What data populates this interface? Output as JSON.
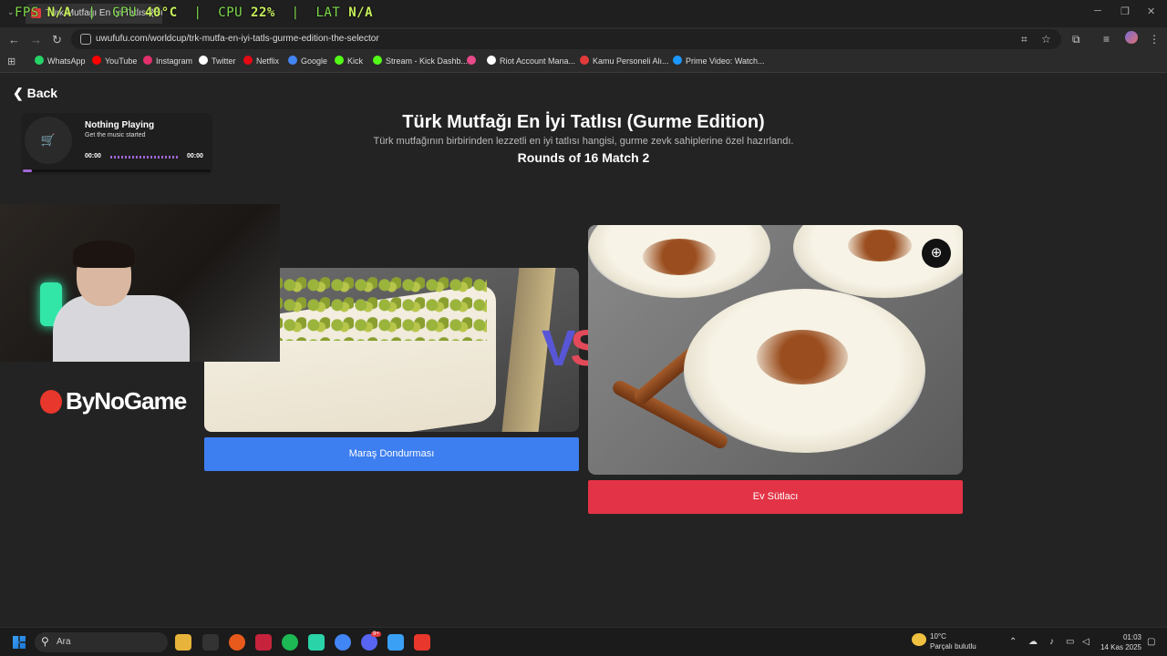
{
  "browser": {
    "tab_title": "Türk Mutfağı En İyi Tatlısı (Gurme",
    "url": "uwufufu.com/worldcup/trk-mutfa-en-iyi-tatls-gurme-edition-the-selector",
    "bookmarks": [
      {
        "label": "WhatsApp",
        "color": "#25d366"
      },
      {
        "label": "YouTube",
        "color": "#ff0000"
      },
      {
        "label": "Instagram",
        "color": "#e1306c"
      },
      {
        "label": "Twitter",
        "color": "#ffffff"
      },
      {
        "label": "Netflix",
        "color": "#e50914"
      },
      {
        "label": "Google",
        "color": "#4285f4"
      },
      {
        "label": "Kick",
        "color": "#53fc18"
      },
      {
        "label": "Stream - Kick Dashb...",
        "color": "#53fc18"
      },
      {
        "label": "",
        "color": "#e84a8a"
      },
      {
        "label": "Riot Account Mana...",
        "color": "#ffffff"
      },
      {
        "label": "Kamu Personeli Alı...",
        "color": "#e23a3a"
      },
      {
        "label": "Prime Video: Watch...",
        "color": "#1a98ff"
      }
    ]
  },
  "overlay": {
    "fps_label": "FPS",
    "fps_value": "N/A",
    "gpu_label": "GPU",
    "gpu_value": "40°C",
    "cpu_label": "CPU",
    "cpu_value": "22%",
    "lat_label": "LAT",
    "lat_value": "N/A"
  },
  "page": {
    "back_label": "Back",
    "title": "Türk Mutfağı En İyi Tatlısı (Gurme Edition)",
    "description": "Türk mutfağının birbirinden lezzetli en iyi tatlısı hangisi, gurme zevk sahiplerine özel hazırlandı.",
    "round": "Rounds of 16 Match 2",
    "vs_v": "V",
    "vs_s": "S",
    "option_left": "Maraş Dondurması",
    "option_right": "Ev Sütlacı"
  },
  "player": {
    "title": "Nothing Playing",
    "subtitle": "Get the music started",
    "time_current": "00:00",
    "time_total": "00:00",
    "progress": 0.05
  },
  "stream": {
    "brand": "ByNoGame"
  },
  "taskbar": {
    "search_placeholder": "Ara",
    "weather_temp": "10°C",
    "weather_desc": "Parçalı bulutlu",
    "time": "01:03",
    "date": "14 Kas 2025",
    "discord_badge": "9+"
  },
  "colors": {
    "option_left": "#3d7ef0",
    "option_right": "#e33346",
    "vs_v": "#5856d6",
    "vs_s": "#e24a5a"
  }
}
